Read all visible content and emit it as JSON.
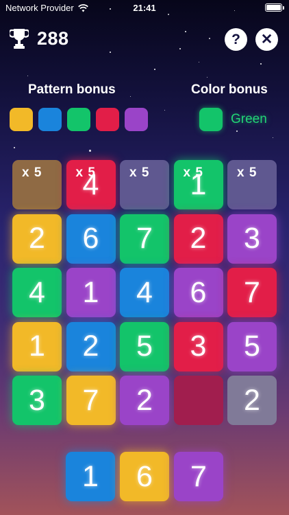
{
  "status_bar": {
    "carrier": "Network Provider",
    "time": "21:41"
  },
  "header": {
    "score": "288",
    "help_label": "?",
    "close_label": "✕"
  },
  "pattern_bonus": {
    "title": "Pattern bonus",
    "colors": [
      "#f2b928",
      "#1a84dc",
      "#13c46a",
      "#e21e48",
      "#9a44c8"
    ]
  },
  "color_bonus": {
    "title": "Color bonus",
    "color": "#13c46a",
    "name": "Green"
  },
  "board": {
    "rows": [
      [
        {
          "value": "",
          "color": "yellow-dim",
          "mult": "x 5"
        },
        {
          "value": "4",
          "color": "red",
          "mult": "x 5"
        },
        {
          "value": "",
          "color": "gray-dim",
          "mult": "x 5"
        },
        {
          "value": "1",
          "color": "green",
          "mult": "x 5"
        },
        {
          "value": "",
          "color": "gray-dim",
          "mult": "x 5"
        }
      ],
      [
        {
          "value": "2",
          "color": "yellow"
        },
        {
          "value": "6",
          "color": "blue"
        },
        {
          "value": "7",
          "color": "green"
        },
        {
          "value": "2",
          "color": "red"
        },
        {
          "value": "3",
          "color": "purple"
        }
      ],
      [
        {
          "value": "4",
          "color": "green"
        },
        {
          "value": "1",
          "color": "purple"
        },
        {
          "value": "4",
          "color": "blue"
        },
        {
          "value": "6",
          "color": "purple"
        },
        {
          "value": "7",
          "color": "red"
        }
      ],
      [
        {
          "value": "1",
          "color": "yellow"
        },
        {
          "value": "2",
          "color": "blue"
        },
        {
          "value": "5",
          "color": "green"
        },
        {
          "value": "3",
          "color": "red"
        },
        {
          "value": "5",
          "color": "purple"
        }
      ],
      [
        {
          "value": "3",
          "color": "green"
        },
        {
          "value": "7",
          "color": "yellow"
        },
        {
          "value": "2",
          "color": "purple"
        },
        {
          "value": "",
          "color": "red-dim"
        },
        {
          "value": "2",
          "color": "gray"
        }
      ]
    ]
  },
  "tray": [
    {
      "value": "1",
      "color": "blue"
    },
    {
      "value": "6",
      "color": "yellow"
    },
    {
      "value": "7",
      "color": "purple"
    }
  ]
}
